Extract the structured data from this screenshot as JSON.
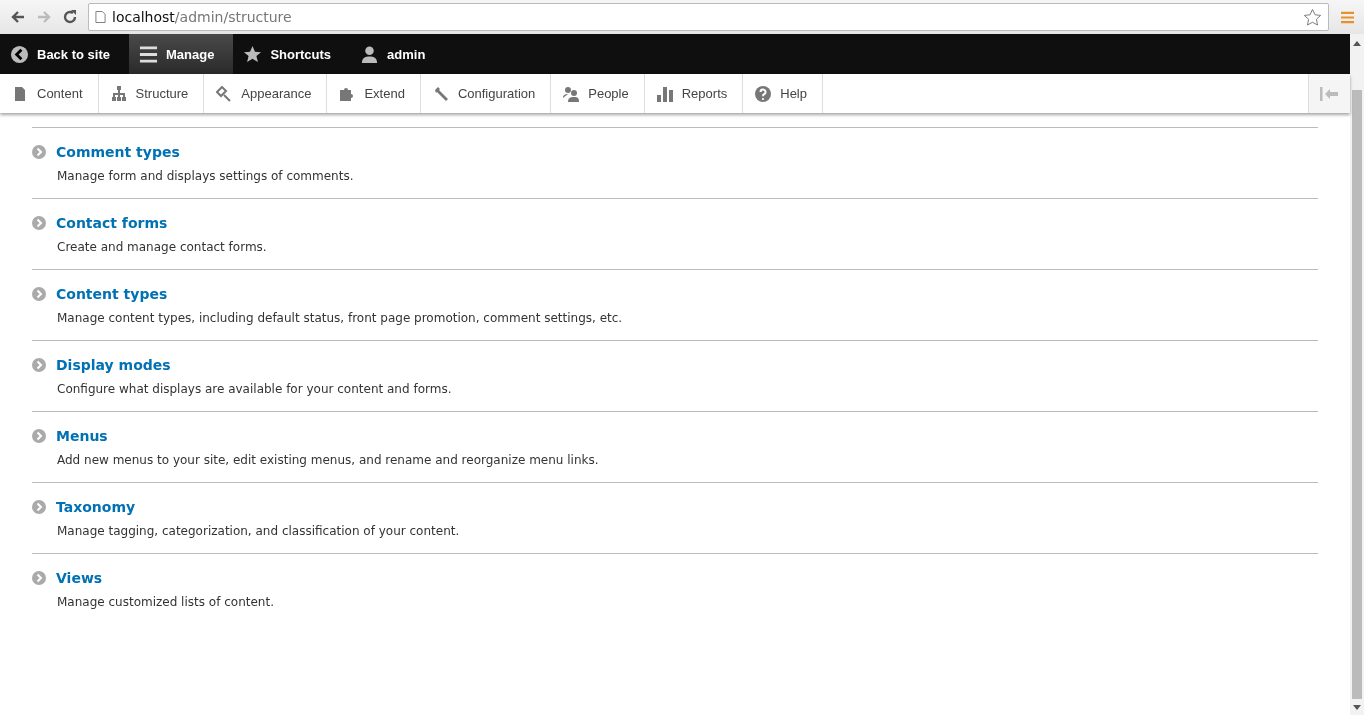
{
  "browser": {
    "url_host": "localhost",
    "url_path": "/admin/structure"
  },
  "toolbar": [
    {
      "label": "Back to site",
      "kind": "back",
      "selected": false
    },
    {
      "label": "Manage",
      "kind": "menu",
      "selected": true
    },
    {
      "label": "Shortcuts",
      "kind": "star",
      "selected": false
    },
    {
      "label": "admin",
      "kind": "user",
      "selected": false
    }
  ],
  "tray": [
    {
      "label": "Content",
      "kind": "file"
    },
    {
      "label": "Structure",
      "kind": "tree"
    },
    {
      "label": "Appearance",
      "kind": "brush"
    },
    {
      "label": "Extend",
      "kind": "puzzle"
    },
    {
      "label": "Configuration",
      "kind": "wrench"
    },
    {
      "label": "People",
      "kind": "people"
    },
    {
      "label": "Reports",
      "kind": "bars"
    },
    {
      "label": "Help",
      "kind": "help"
    }
  ],
  "items": [
    {
      "title": "Comment types",
      "description": "Manage form and displays settings of comments."
    },
    {
      "title": "Contact forms",
      "description": "Create and manage contact forms."
    },
    {
      "title": "Content types",
      "description": "Manage content types, including default status, front page promotion, comment settings, etc."
    },
    {
      "title": "Display modes",
      "description": "Configure what displays are available for your content and forms."
    },
    {
      "title": "Menus",
      "description": "Add new menus to your site, edit existing menus, and rename and reorganize menu links."
    },
    {
      "title": "Taxonomy",
      "description": "Manage tagging, categorization, and classification of your content."
    },
    {
      "title": "Views",
      "description": "Manage customized lists of content."
    }
  ]
}
